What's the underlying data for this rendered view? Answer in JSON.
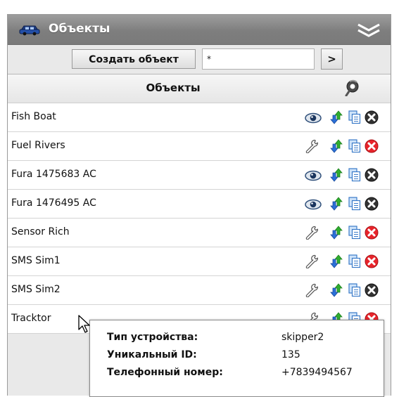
{
  "header": {
    "title": "Объекты"
  },
  "toolbar": {
    "create_label": "Создать объект",
    "filter_value": "*",
    "go_label": ">"
  },
  "table": {
    "header": "Объекты",
    "rows": [
      {
        "name": "Fish Boat",
        "first_icon": "eye-icon",
        "last_icon": "gray-x-circle-icon"
      },
      {
        "name": "Fuel Rivers",
        "first_icon": "wrench-icon",
        "last_icon": "red-x-circle-icon"
      },
      {
        "name": "Fura 1475683 AC",
        "first_icon": "eye-icon",
        "last_icon": "gray-x-circle-icon"
      },
      {
        "name": "Fura 1476495 AC",
        "first_icon": "eye-icon",
        "last_icon": "gray-x-circle-icon"
      },
      {
        "name": "Sensor Rich",
        "first_icon": "wrench-icon",
        "last_icon": "red-x-circle-icon"
      },
      {
        "name": "SMS Sim1",
        "first_icon": "wrench-icon",
        "last_icon": "red-x-circle-icon"
      },
      {
        "name": "SMS Sim2",
        "first_icon": "wrench-icon",
        "last_icon": "gray-x-circle-icon"
      },
      {
        "name": "Tracktor",
        "first_icon": "wrench-icon",
        "last_icon": "red-x-circle-icon"
      }
    ]
  },
  "tooltip": {
    "device_type_label": "Тип устройства:",
    "device_type_value": "skipper2",
    "unique_id_label": "Уникальный ID:",
    "unique_id_value": "135",
    "phone_label": "Телефонный номер:",
    "phone_value": "+7839494567"
  },
  "colors": {
    "header_bg": "#888888",
    "panel_bg": "#e9e9e9",
    "delete_red": "#e8242b",
    "delete_gray": "#333333",
    "arrow_green": "#29a829",
    "arrow_blue": "#2a6fd6"
  }
}
